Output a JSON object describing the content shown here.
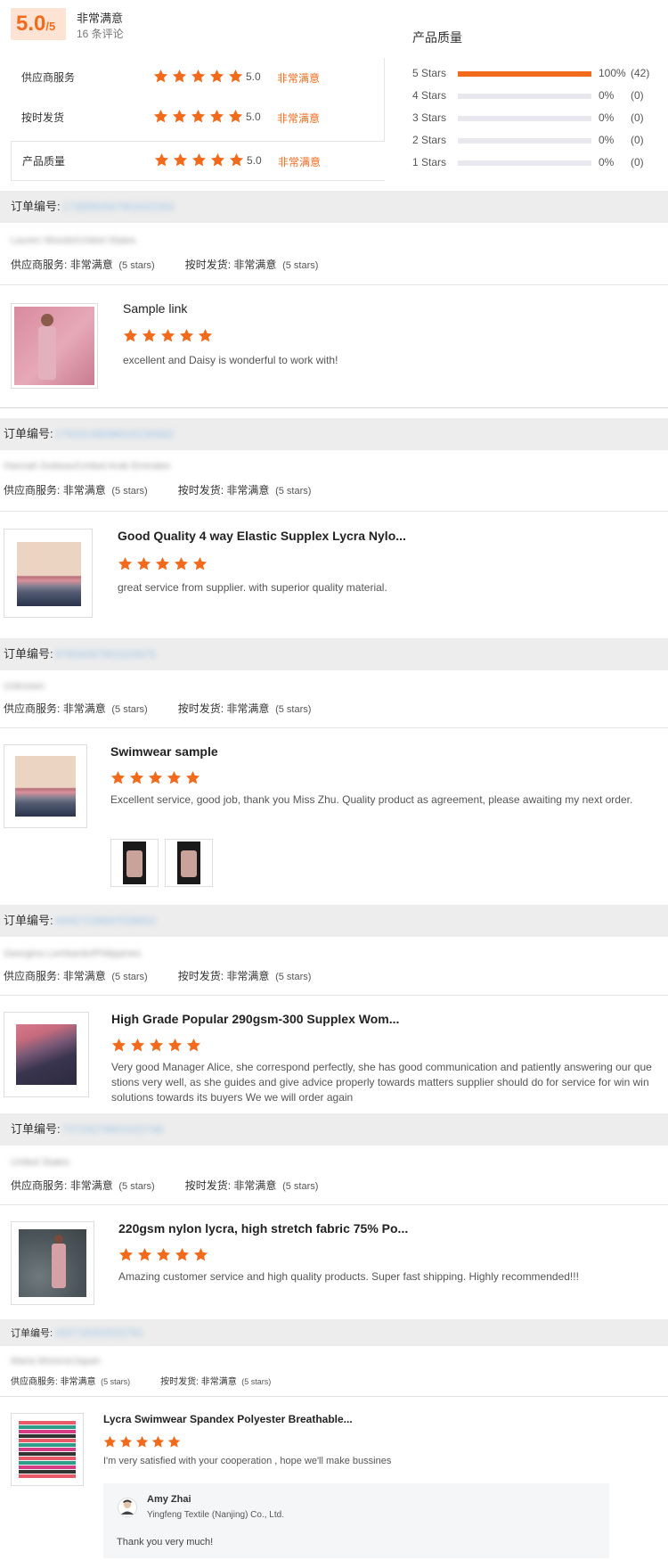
{
  "summary": {
    "score": "5.0",
    "score_max": "/5",
    "overall_label": "非常满意",
    "review_count": "16 条评论",
    "ratings": [
      {
        "label": "供应商服务",
        "value": "5.0",
        "text": "非常满意",
        "stars": 5
      },
      {
        "label": "按时发货",
        "value": "5.0",
        "text": "非常满意",
        "stars": 5
      },
      {
        "label": "产品质量",
        "value": "5.0",
        "text": "非常满意",
        "stars": 5
      }
    ],
    "quality_title": "产品质量",
    "distribution": [
      {
        "label": "5 Stars",
        "fraction": 1.0,
        "pct": "100%",
        "count": "(42)"
      },
      {
        "label": "4 Stars",
        "fraction": 0,
        "pct": "0%",
        "count": "(0)"
      },
      {
        "label": "3 Stars",
        "fraction": 0,
        "pct": "0%",
        "count": "(0)"
      },
      {
        "label": "2 Stars",
        "fraction": 0,
        "pct": "0%",
        "count": "(0)"
      },
      {
        "label": "1 Stars",
        "fraction": 0,
        "pct": "0%",
        "count": "(0)"
      }
    ]
  },
  "labels": {
    "order_no": "订单编号:",
    "supplier_service": "供应商服务:",
    "on_time": "按时发货:",
    "very_satisfied": "非常满意",
    "five_stars": "(5 stars)"
  },
  "reviews": [
    {
      "order_id": "1738992567901022302",
      "location": "Lauren Woods/United States",
      "title": "Sample link",
      "stars": 5,
      "comment": "excellent and Daisy is wonderful to work with!"
    },
    {
      "order_id": "17633148098015230662",
      "location": "Hannah Dubeau/United Arab Emirates",
      "title": "Good Quality 4 way Elastic Supplex Lycra Nylo...",
      "stars": 5,
      "comment": "great service from supplier. with superior quality material."
    },
    {
      "order_id": "97856087901024675",
      "location": "Unknown",
      "title": "Swimwear sample",
      "stars": 5,
      "comment": "Excellent service, good job, thank you Miss Zhu. Quality product as agreement, please awaiting my next order."
    },
    {
      "order_id": "44057238697028652",
      "location": "Georgina Lombardo/Philippines",
      "title": "High Grade Popular 290gsm-300 Supplex Wom...",
      "stars": 5,
      "comment": "Very good Manager Alice, she correspond perfectly, she has good communication and patiently answering our questions very well,  as she guides and give advice properly towards matters supplier should do for service for win win solutions towards its buyers We we will order again"
    },
    {
      "order_id": "73729279901022748",
      "location": "United States",
      "title": "220gsm nylon lycra, high stretch fabric 75% Po...",
      "stars": 5,
      "comment": "Amazing customer service and high quality products. Super fast shipping. Highly recommended!!!"
    },
    {
      "order_id": "163718302533781",
      "location": "Maria Moreno/Japan",
      "title": "Lycra Swimwear Spandex Polyester Breathable...",
      "stars": 5,
      "comment": "I'm very satisfied with your cooperation , hope we'll make bussines"
    }
  ],
  "reply": {
    "name": "Amy Zhai",
    "company": "Yingfeng Textile (Nanjing) Co., Ltd.",
    "text": "Thank you very much!"
  },
  "colors": {
    "accent": "#f26b1d",
    "badge_bg": "#fde3d3",
    "order_bar": "#ededed"
  }
}
